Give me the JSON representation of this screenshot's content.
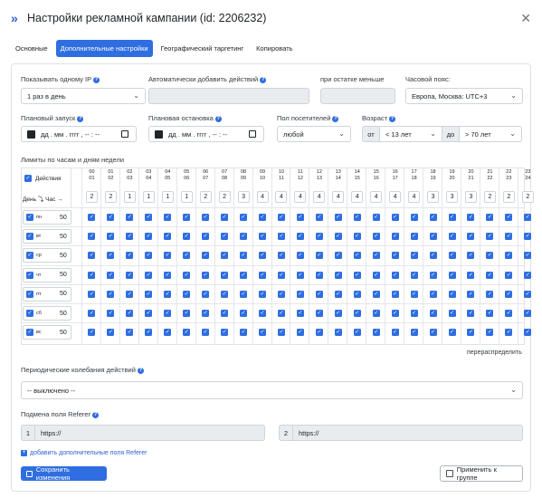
{
  "title": "Настройки рекламной кампании (id: 2206232)",
  "tabs": [
    "Основные",
    "Дополнительные настройки",
    "Географический таргетинг",
    "Копировать"
  ],
  "fields": {
    "show_one_ip_label": "Показывать одному IP",
    "show_one_ip_value": "1 раз в день",
    "auto_add_label": "Автоматически добавить действий",
    "remaining_label": "при остатке меньше",
    "timezone_label": "Часовой пояс:",
    "timezone_value": "Европа, Москва: UTC+3",
    "planned_start_label": "Плановый запуск",
    "planned_stop_label": "Плановая остановка",
    "date_placeholder": "дд . мм . гггг ,  -- : --",
    "gender_label": "Пол посетителей",
    "gender_value": "любой",
    "age_label": "Возраст",
    "age_from_prefix": "от",
    "age_from_value": "< 13 лет",
    "age_to_prefix": "до",
    "age_to_value": "> 70 лет"
  },
  "schedule": {
    "title": "Лимиты по часам и дням недели",
    "actions_label": "Действия",
    "day_hour_label": "День ⤵ Час →",
    "hours": [
      [
        "00",
        "01"
      ],
      [
        "01",
        "02"
      ],
      [
        "02",
        "03"
      ],
      [
        "03",
        "04"
      ],
      [
        "04",
        "05"
      ],
      [
        "05",
        "06"
      ],
      [
        "06",
        "07"
      ],
      [
        "07",
        "08"
      ],
      [
        "08",
        "09"
      ],
      [
        "09",
        "10"
      ],
      [
        "10",
        "11"
      ],
      [
        "11",
        "12"
      ],
      [
        "12",
        "13"
      ],
      [
        "13",
        "14"
      ],
      [
        "14",
        "15"
      ],
      [
        "15",
        "16"
      ],
      [
        "16",
        "17"
      ],
      [
        "17",
        "18"
      ],
      [
        "18",
        "19"
      ],
      [
        "19",
        "20"
      ],
      [
        "20",
        "21"
      ],
      [
        "21",
        "22"
      ],
      [
        "22",
        "23"
      ],
      [
        "23",
        "24"
      ]
    ],
    "hour_limits": [
      "2",
      "2",
      "1",
      "1",
      "1",
      "1",
      "2",
      "2",
      "3",
      "4",
      "4",
      "4",
      "4",
      "4",
      "4",
      "4",
      "4",
      "4",
      "3",
      "3",
      "3",
      "2",
      "2",
      "2"
    ],
    "days": [
      {
        "tag": "пн",
        "limit": "50"
      },
      {
        "tag": "вт",
        "limit": "50"
      },
      {
        "tag": "ср",
        "limit": "50"
      },
      {
        "tag": "чт",
        "limit": "50"
      },
      {
        "tag": "пт",
        "limit": "50"
      },
      {
        "tag": "сб",
        "limit": "50"
      },
      {
        "tag": "вс",
        "limit": "50"
      }
    ],
    "redistribute_label": "перераспределить"
  },
  "periodic": {
    "label": "Периодические колебания действий",
    "value": "-- выключено --"
  },
  "referer": {
    "label": "Подмена поля Referer",
    "fields": [
      {
        "index": "1",
        "value": "https://"
      },
      {
        "index": "2",
        "value": "https://"
      }
    ],
    "add_label": "добавить дополнительные поля Referer"
  },
  "buttons": {
    "save": "Сохранить изменения",
    "apply_group": "Применить к группе"
  },
  "colors": {
    "accent": "#2f6ee0"
  }
}
